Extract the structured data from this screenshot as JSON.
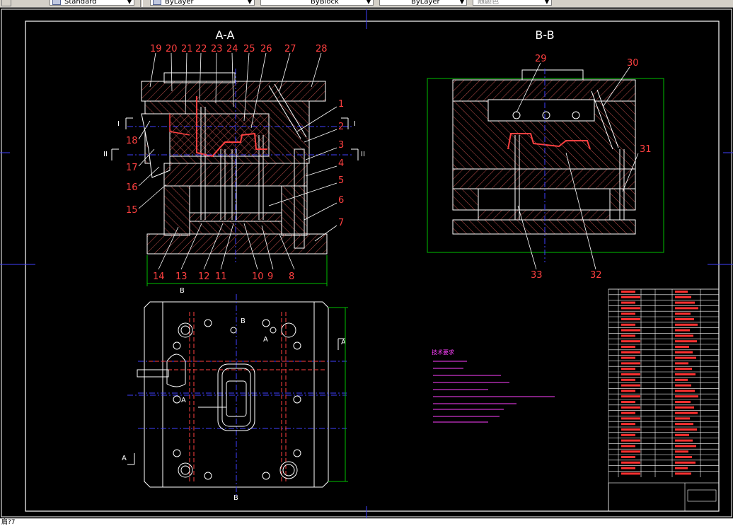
{
  "toolbar": {
    "text_style": "Standard",
    "layer": "ByLayer",
    "linetype": "ByBlock",
    "lineweight": "ByLayer",
    "plot_style": "随颜色"
  },
  "drawing": {
    "section_aa_title": "A-A",
    "section_bb_title": "B-B",
    "callouts_aa": [
      "19",
      "20",
      "21",
      "22",
      "23",
      "24",
      "25",
      "26",
      "27",
      "28",
      "1",
      "2",
      "3",
      "4",
      "5",
      "6",
      "7",
      "18",
      "17",
      "16",
      "15",
      "14",
      "13",
      "12",
      "11",
      "10",
      "9",
      "8"
    ],
    "callouts_bb": [
      "29",
      "30",
      "31",
      "32",
      "33"
    ],
    "section_marks": [
      "I",
      "I",
      "II",
      "II",
      "B",
      "B",
      "B",
      "A",
      "A",
      "A",
      "A"
    ],
    "tech_notes_title": "技术要求"
  },
  "status": {
    "command_line": "肩?7"
  }
}
